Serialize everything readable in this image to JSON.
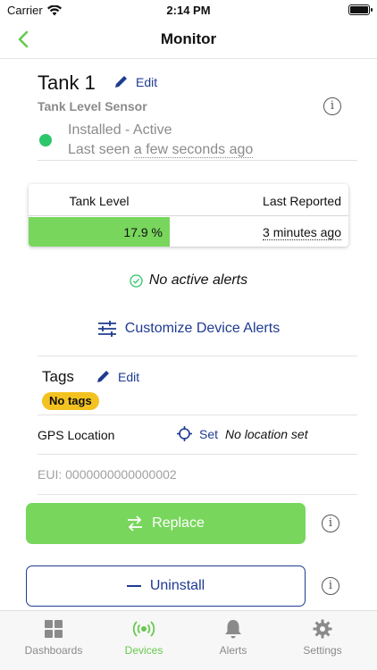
{
  "status_bar": {
    "carrier": "Carrier",
    "time": "2:14 PM"
  },
  "nav": {
    "title": "Monitor",
    "back_icon": "chevron-left-icon"
  },
  "device": {
    "name": "Tank 1",
    "edit_label": "Edit",
    "type": "Tank Level Sensor",
    "status": "Installed - Active",
    "last_seen_prefix": "Last seen",
    "last_seen_value": "a few seconds ago",
    "status_color": "#2ec66b"
  },
  "level_card": {
    "col1_header": "Tank Level",
    "col2_header": "Last Reported",
    "level_value": "17.9 %",
    "level_fraction": 0.179,
    "last_reported": "3 minutes ago"
  },
  "alerts": {
    "no_alerts": "No active alerts",
    "customize_label": "Customize Device Alerts"
  },
  "tags": {
    "label": "Tags",
    "edit_label": "Edit",
    "empty_pill": "No tags"
  },
  "gps": {
    "label": "GPS Location",
    "set_label": "Set",
    "value": "No location set"
  },
  "eui": {
    "text": "EUI: 0000000000000002"
  },
  "actions": {
    "replace_label": "Replace",
    "uninstall_label": "Uninstall"
  },
  "tabbar": {
    "tabs": [
      {
        "label": "Dashboards",
        "icon": "grid-icon"
      },
      {
        "label": "Devices",
        "icon": "broadcast-icon"
      },
      {
        "label": "Alerts",
        "icon": "bell-icon"
      },
      {
        "label": "Settings",
        "icon": "gear-icon"
      }
    ],
    "active": "Devices"
  },
  "colors": {
    "accent_green": "#78d65d",
    "brand_blue": "#1f3b91",
    "tag_yellow": "#f3c220"
  }
}
